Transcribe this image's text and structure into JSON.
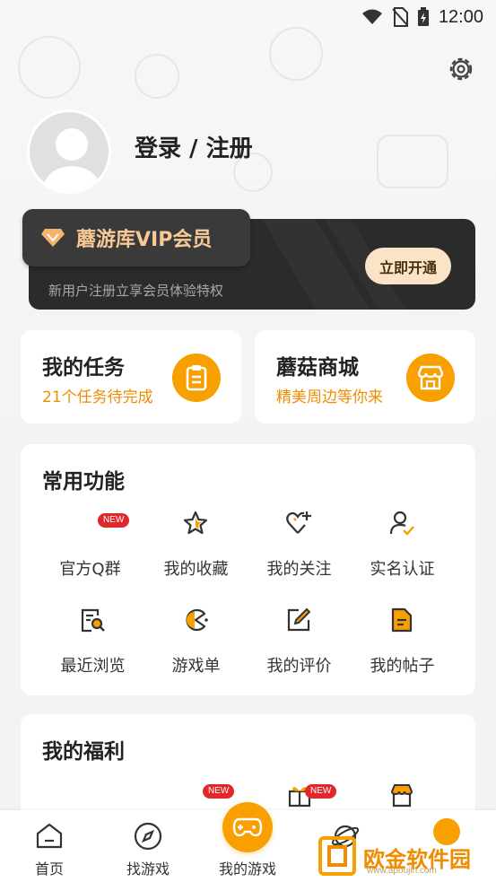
{
  "status_bar": {
    "time": "12:00"
  },
  "profile": {
    "login_label": "登录 / 注册"
  },
  "vip": {
    "title": "蘑游库VIP会员",
    "subtitle": "新用户注册立享会员体验特权",
    "button": "立即开通"
  },
  "quick_cards": [
    {
      "title": "我的任务",
      "subtitle": "21个任务待完成",
      "icon": "clipboard-icon"
    },
    {
      "title": "蘑菇商城",
      "subtitle": "精美周边等你来",
      "icon": "store-icon"
    }
  ],
  "common": {
    "title": "常用功能",
    "items": [
      {
        "label": "官方Q群",
        "icon": "qq-group-icon",
        "badge": "NEW"
      },
      {
        "label": "我的收藏",
        "icon": "star-icon"
      },
      {
        "label": "我的关注",
        "icon": "heart-plus-icon"
      },
      {
        "label": "实名认证",
        "icon": "user-check-icon"
      },
      {
        "label": "最近浏览",
        "icon": "history-search-icon"
      },
      {
        "label": "游戏单",
        "icon": "pacman-icon"
      },
      {
        "label": "我的评价",
        "icon": "edit-icon"
      },
      {
        "label": "我的帖子",
        "icon": "post-icon"
      }
    ]
  },
  "welfare": {
    "title": "我的福利",
    "badges": [
      "NEW",
      "NEW"
    ]
  },
  "bottom_nav": [
    {
      "label": "首页",
      "icon": "home-icon"
    },
    {
      "label": "找游戏",
      "icon": "compass-icon"
    },
    {
      "label": "我的游戏",
      "icon": "gamepad-icon"
    },
    {
      "label": "",
      "icon": "planet-icon"
    }
  ],
  "watermark": {
    "text": "欧金软件园",
    "sub": "www.apoujin.com"
  },
  "colors": {
    "accent": "#f7a000",
    "accent_text": "#f08c00",
    "vip_gold": "#f6c995",
    "vip_dark": "#2b2b2b",
    "badge_red": "#e0282c"
  }
}
